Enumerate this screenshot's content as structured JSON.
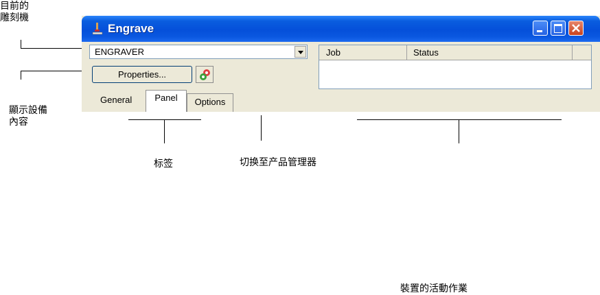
{
  "annotations": {
    "current_engraver": "目前的\n雕刻機",
    "display_content": "顯示設備\n內容",
    "tabs": "标签",
    "switch_manager": "切换至产品管理器",
    "active_jobs": "裝置的活動作業"
  },
  "window": {
    "title": "Engrave",
    "icon": "engraver-app-icon",
    "controls": [
      "minimize",
      "maximize",
      "close"
    ]
  },
  "device_select": {
    "value": "ENGRAVER"
  },
  "properties_button": {
    "label": "Properties..."
  },
  "product_manager_button": {
    "icon": "gears-icon"
  },
  "tabs": [
    "General",
    "Panel",
    "Options"
  ],
  "active_tab": "Panel",
  "job_list": {
    "columns": [
      "Job",
      "Status"
    ],
    "rows": []
  },
  "colors": {
    "titlebar": "#0550da",
    "close_button": "#c9421c",
    "window_bg": "#ece9d8"
  }
}
